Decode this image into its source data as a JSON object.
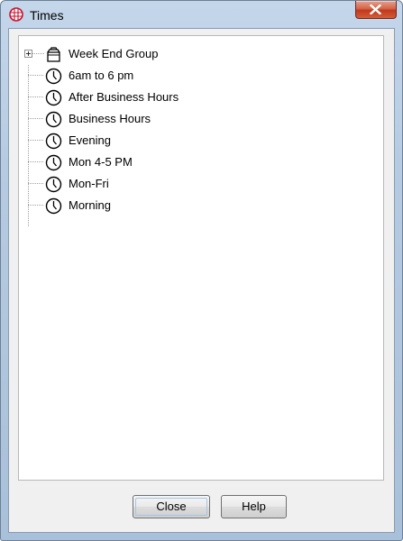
{
  "window": {
    "title": "Times",
    "accent_color": "#c0391c",
    "app_icon": "globe-grid-icon",
    "close_icon": "close-x-icon"
  },
  "tree": {
    "group": {
      "label": "Week End Group",
      "icon": "folder-group-icon",
      "expanded": false
    },
    "items": [
      {
        "label": "6am to 6 pm",
        "icon": "clock-icon"
      },
      {
        "label": "After Business Hours",
        "icon": "clock-icon"
      },
      {
        "label": "Business Hours",
        "icon": "clock-icon"
      },
      {
        "label": "Evening",
        "icon": "clock-icon"
      },
      {
        "label": "Mon 4-5 PM",
        "icon": "clock-icon"
      },
      {
        "label": "Mon-Fri",
        "icon": "clock-icon"
      },
      {
        "label": "Morning",
        "icon": "clock-icon"
      }
    ]
  },
  "buttons": {
    "close_label": "Close",
    "help_label": "Help"
  }
}
